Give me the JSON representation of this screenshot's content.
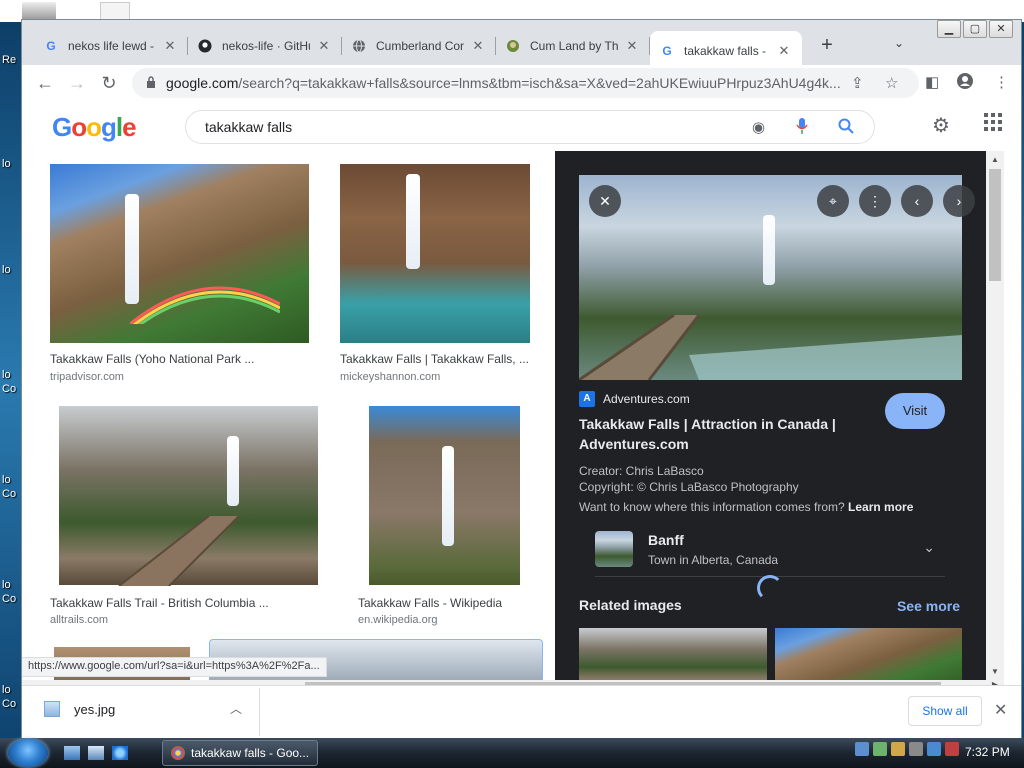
{
  "desktop": {
    "icon_labels": [
      "Re",
      "lo",
      "lo",
      "lo",
      "Co",
      "lo",
      "Co",
      "lo",
      "Co",
      "lo",
      "Co"
    ]
  },
  "browser": {
    "tabs": [
      {
        "title": "nekos life lewd -",
        "favicon": "google-icon",
        "active": false
      },
      {
        "title": "nekos-life · GitHu",
        "favicon": "github-icon",
        "active": false
      },
      {
        "title": "Cumberland Cor",
        "favicon": "globe-icon",
        "active": false
      },
      {
        "title": "Cum Land by The",
        "favicon": "site-icon",
        "active": false
      },
      {
        "title": "takakkaw falls - G",
        "favicon": "google-icon",
        "active": true
      }
    ],
    "new_tab": "+",
    "url_host": "google.com",
    "url_rest": "/search?q=takakkaw+falls&source=lnms&tbm=isch&sa=X&ved=2ahUKEwiuuPHrpuz3AhU4g4k..."
  },
  "google": {
    "logo_letters": [
      "G",
      "o",
      "o",
      "g",
      "l",
      "e"
    ],
    "query": "takakkaw falls",
    "results": [
      {
        "caption": "Takakkaw Falls (Yoho National Park ...",
        "source": "tripadvisor.com"
      },
      {
        "caption": "Takakkaw Falls | Takakkaw Falls, ...",
        "source": "mickeyshannon.com"
      },
      {
        "caption": "Takakkaw Falls Trail - British Columbia ...",
        "source": "alltrails.com"
      },
      {
        "caption": "Takakkaw Falls - Wikipedia",
        "source": "en.wikipedia.org"
      }
    ],
    "panel": {
      "site": "Adventures.com",
      "site_favicon_letter": "A",
      "title": "Takakkaw Falls | Attraction in Canada | Adventures.com",
      "visit": "Visit",
      "creator": "Creator: Chris LaBasco",
      "copyright": "Copyright: © Chris LaBasco Photography",
      "info_question": "Want to know where this information comes from?",
      "learn_more": "Learn more",
      "kp_name": "Banff",
      "kp_desc": "Town in Alberta, Canada",
      "related": "Related images",
      "see_more": "See more"
    },
    "status_url": "https://www.google.com/url?sa=i&url=https%3A%2F%2Fa..."
  },
  "download_shelf": {
    "file": "yes.jpg",
    "show_all": "Show all"
  },
  "taskbar": {
    "window_title": "takakkaw falls - Goo...",
    "clock": "7:32 PM"
  }
}
